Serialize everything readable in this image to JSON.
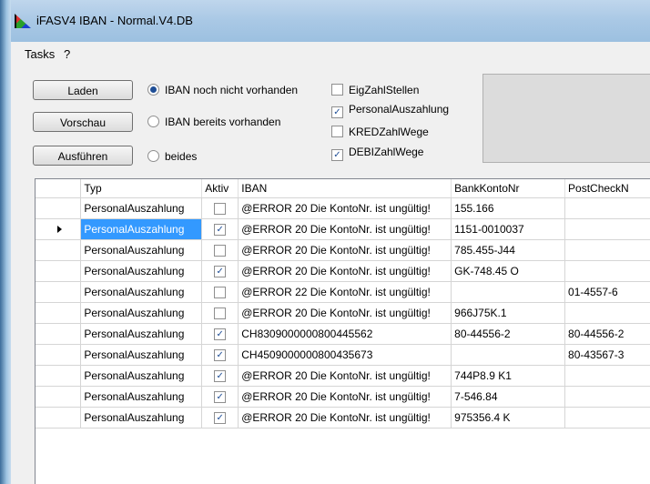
{
  "window": {
    "title": "iFASV4 IBAN - Normal.V4.DB"
  },
  "menu": [
    {
      "label": "Tasks"
    },
    {
      "label": "?"
    }
  ],
  "buttons": {
    "laden": "Laden",
    "vorschau": "Vorschau",
    "ausfuehren": "Ausführen"
  },
  "radios": [
    {
      "label": "IBAN noch nicht vorhanden",
      "checked": true
    },
    {
      "label": "IBAN bereits vorhanden",
      "checked": false
    },
    {
      "label": "beides",
      "checked": false
    }
  ],
  "checkboxes": [
    {
      "label": "EigZahlStellen",
      "checked": false
    },
    {
      "label": "PersonalAuszahlung",
      "checked": true
    },
    {
      "label": "KREDZahlWege",
      "checked": false
    },
    {
      "label": "DEBIZahlWege",
      "checked": true
    }
  ],
  "grid": {
    "columns": [
      "Typ",
      "Aktiv",
      "IBAN",
      "BankKontoNr",
      "PostCheckN"
    ],
    "current_row_index": 1,
    "rows": [
      {
        "typ": "PersonalAuszahlung",
        "aktiv": false,
        "iban": "@ERROR 20 Die KontoNr. ist ungültig!",
        "bank": "155.166",
        "post": ""
      },
      {
        "typ": "PersonalAuszahlung",
        "aktiv": true,
        "iban": "@ERROR 20 Die KontoNr. ist ungültig!",
        "bank": "1151-0010037",
        "post": ""
      },
      {
        "typ": "PersonalAuszahlung",
        "aktiv": false,
        "iban": "@ERROR 20 Die KontoNr. ist ungültig!",
        "bank": "785.455-J44",
        "post": ""
      },
      {
        "typ": "PersonalAuszahlung",
        "aktiv": true,
        "iban": "@ERROR 20 Die KontoNr. ist ungültig!",
        "bank": "GK-748.45 O",
        "post": ""
      },
      {
        "typ": "PersonalAuszahlung",
        "aktiv": false,
        "iban": "@ERROR 22 Die KontoNr. ist ungültig!",
        "bank": "",
        "post": "01-4557-6"
      },
      {
        "typ": "PersonalAuszahlung",
        "aktiv": false,
        "iban": "@ERROR 20 Die KontoNr. ist ungültig!",
        "bank": "966J75K.1",
        "post": ""
      },
      {
        "typ": "PersonalAuszahlung",
        "aktiv": true,
        "iban": "CH8309000000800445562",
        "bank": "80-44556-2",
        "post": "80-44556-2"
      },
      {
        "typ": "PersonalAuszahlung",
        "aktiv": true,
        "iban": "CH4509000000800435673",
        "bank": "",
        "post": "80-43567-3"
      },
      {
        "typ": "PersonalAuszahlung",
        "aktiv": true,
        "iban": "@ERROR 20 Die KontoNr. ist ungültig!",
        "bank": "744P8.9 K1",
        "post": ""
      },
      {
        "typ": "PersonalAuszahlung",
        "aktiv": true,
        "iban": "@ERROR 20 Die KontoNr. ist ungültig!",
        "bank": "7-546.84",
        "post": ""
      },
      {
        "typ": "PersonalAuszahlung",
        "aktiv": true,
        "iban": "@ERROR 20 Die KontoNr. ist ungültig!",
        "bank": "975356.4 K",
        "post": ""
      }
    ]
  }
}
